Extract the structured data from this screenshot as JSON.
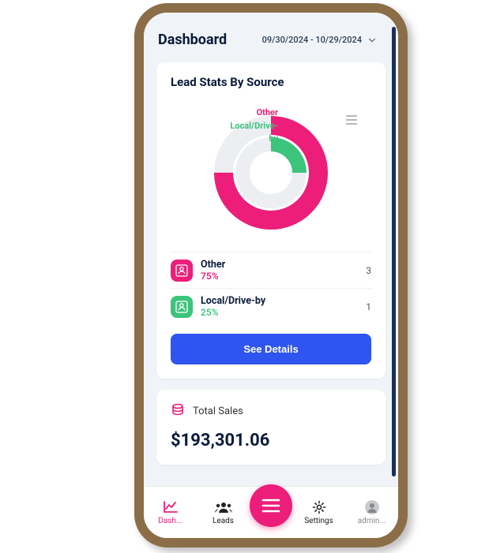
{
  "header": {
    "title": "Dashboard",
    "date_range": "09/30/2024 - 10/29/2024"
  },
  "lead_stats": {
    "title": "Lead Stats By Source",
    "label_other": "Other",
    "label_local": "Local/Drive-by",
    "items": [
      {
        "name": "Other",
        "pct": "75%",
        "count": "3"
      },
      {
        "name": "Local/Drive-by",
        "pct": "25%",
        "count": "1"
      }
    ],
    "details_btn": "See Details"
  },
  "total_sales": {
    "label": "Total Sales",
    "value": "$193,301.06"
  },
  "nav": {
    "dashboard": "Dash...",
    "leads": "Leads",
    "settings": "Settings",
    "admin": "admin..."
  },
  "colors": {
    "pink": "#ec1e79",
    "green": "#3cc47c",
    "blue": "#2f55f0",
    "grey": "#eceef1",
    "frame": "#8b6e47"
  },
  "chart_data": {
    "type": "pie",
    "title": "Lead Stats By Source",
    "series": [
      {
        "name": "Other",
        "value": 75,
        "count": 3,
        "color": "#ec1e79"
      },
      {
        "name": "Local/Drive-by",
        "value": 25,
        "count": 1,
        "color": "#3cc47c"
      }
    ]
  }
}
